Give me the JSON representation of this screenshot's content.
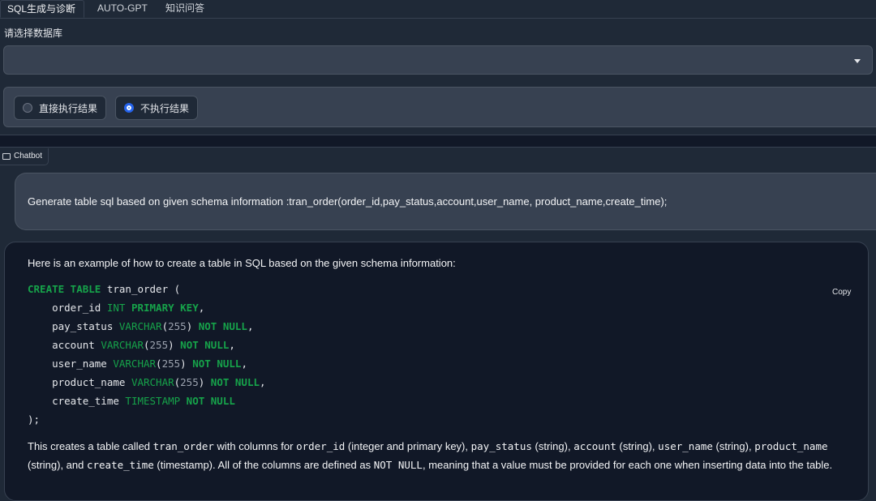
{
  "tabs": [
    "SQL生成与诊断",
    "AUTO-GPT",
    "知识问答"
  ],
  "database_label": "请选择数据库",
  "database_select_value": "",
  "radio_options": [
    {
      "label": "直接执行结果",
      "checked": false
    },
    {
      "label": "不执行结果",
      "checked": true
    }
  ],
  "chatbot": {
    "label": "Chatbot",
    "user_message": "Generate table sql based on given schema information :tran_order(order_id,pay_status,account,user_name, product_name,create_time);",
    "bot_intro": "Here is an example of how to create a table in SQL based on the given schema information:",
    "copy_label": "Copy",
    "code": {
      "line1": {
        "kw1": "CREATE TABLE",
        "name": " tran_order (",
        "rest": ""
      },
      "line2": {
        "name": "    order_id ",
        "type": "INT",
        "kw": " PRIMARY KEY",
        "end": ","
      },
      "line3": {
        "name": "    pay_status ",
        "type": "VARCHAR",
        "lp": "(",
        "num": "255",
        "rp": ") ",
        "kw": "NOT NULL",
        "end": ","
      },
      "line4": {
        "name": "    account ",
        "type": "VARCHAR",
        "lp": "(",
        "num": "255",
        "rp": ") ",
        "kw": "NOT NULL",
        "end": ","
      },
      "line5": {
        "name": "    user_name ",
        "type": "VARCHAR",
        "lp": "(",
        "num": "255",
        "rp": ") ",
        "kw": "NOT NULL",
        "end": ","
      },
      "line6": {
        "name": "    product_name ",
        "type": "VARCHAR",
        "lp": "(",
        "num": "255",
        "rp": ") ",
        "kw": "NOT NULL",
        "end": ","
      },
      "line7": {
        "name": "    create_time ",
        "type": "TIMESTAMP",
        "kw": " NOT NULL"
      },
      "line8": ");"
    },
    "outro": {
      "t1": "This creates a table called ",
      "c1": "tran_order",
      "t2": " with columns for ",
      "c2": "order_id",
      "t3": " (integer and primary key), ",
      "c3": "pay_status",
      "t4": " (string), ",
      "c4": "account",
      "t5": " (string), ",
      "c5": "user_name",
      "t6": " (string), ",
      "c6": "product_name",
      "t7": " (string), and ",
      "c7": "create_time",
      "t8": " (timestamp). All of the columns are defined as ",
      "c8": "NOT NULL",
      "t9": ", meaning that a value must be provided for each one when inserting data into the table."
    }
  }
}
